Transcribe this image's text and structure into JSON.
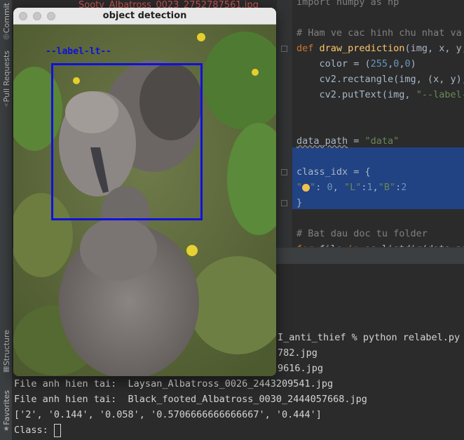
{
  "background_tab_title": "Sooty_Albatross_0023_2752787561.jpg",
  "left_strip": {
    "commit_label": "Commit",
    "pull_requests_label": "Pull Requests",
    "structure_label": "Structure",
    "favorites_label": "Favorites"
  },
  "editor": {
    "lines": [
      {
        "segments": [
          {
            "t": "import numpy as np",
            "cls": "c"
          }
        ]
      },
      {
        "segments": []
      },
      {
        "segments": [
          {
            "t": "# Ham ve cac hinh chu nhat va t",
            "cls": "c"
          }
        ]
      },
      {
        "segments": [
          {
            "t": "def ",
            "cls": "k"
          },
          {
            "t": "draw_prediction",
            "cls": "fn"
          },
          {
            "t": "(img, x, y, ",
            "cls": ""
          }
        ]
      },
      {
        "segments": [
          {
            "t": "    color = (",
            "cls": ""
          },
          {
            "t": "255",
            "cls": "n"
          },
          {
            "t": ",",
            "cls": ""
          },
          {
            "t": "0",
            "cls": "n"
          },
          {
            "t": ",",
            "cls": ""
          },
          {
            "t": "0",
            "cls": "n"
          },
          {
            "t": ")",
            "cls": ""
          }
        ]
      },
      {
        "segments": [
          {
            "t": "    cv2.rectangle(img, (x, y), ",
            "cls": ""
          }
        ]
      },
      {
        "segments": [
          {
            "t": "    cv2.putText(img, ",
            "cls": ""
          },
          {
            "t": "\"--label-i",
            "cls": "s"
          }
        ]
      },
      {
        "segments": []
      },
      {
        "segments": []
      },
      {
        "segments": [
          {
            "t": "data_path",
            "cls": "u"
          },
          {
            "t": " = ",
            "cls": ""
          },
          {
            "t": "\"data\"",
            "cls": "s"
          }
        ]
      },
      {
        "segments": []
      },
      {
        "segments": [
          {
            "t": "class_idx = {",
            "cls": ""
          }
        ]
      },
      {
        "segments": [
          {
            "t": "\"",
            "cls": "s"
          },
          {
            "t": "BULB",
            "cls": "bulb"
          },
          {
            "t": "\"",
            "cls": "s"
          },
          {
            "t": ": ",
            "cls": ""
          },
          {
            "t": "0",
            "cls": "n"
          },
          {
            "t": ", ",
            "cls": ""
          },
          {
            "t": "\"L\"",
            "cls": "s"
          },
          {
            "t": ":",
            "cls": ""
          },
          {
            "t": "1",
            "cls": "n"
          },
          {
            "t": ",",
            "cls": ""
          },
          {
            "t": "\"B\"",
            "cls": "s"
          },
          {
            "t": ":",
            "cls": ""
          },
          {
            "t": "2",
            "cls": "n"
          }
        ]
      },
      {
        "segments": [
          {
            "t": "}",
            "cls": ""
          }
        ]
      },
      {
        "segments": []
      },
      {
        "segments": [
          {
            "t": "# Bat dau doc tu folder",
            "cls": "c"
          }
        ]
      },
      {
        "segments": [
          {
            "t": "for ",
            "cls": "k"
          },
          {
            "t": "file ",
            "cls": ""
          },
          {
            "t": "in ",
            "cls": "k"
          },
          {
            "t": "os.listdir(data_pat",
            "cls": ""
          }
        ]
      }
    ]
  },
  "terminal": {
    "prompt_line": "I_anti_thief % python relabel.py",
    "partial_line_1": "782.jpg",
    "partial_line_2": "9616.jpg",
    "line_3": "File anh hien tai:  Laysan_Albatross_0026_2443209541.jpg",
    "line_4": "File anh hien tai:  Black_footed_Albatross_0030_2444057668.jpg",
    "line_5": "['2', '0.144', '0.058', '0.5706666666666667', '0.444']",
    "input_label": "Class: "
  },
  "image_window": {
    "title": "object detection",
    "detection_label": "--label-lt--",
    "box_color": "#1010e0"
  }
}
